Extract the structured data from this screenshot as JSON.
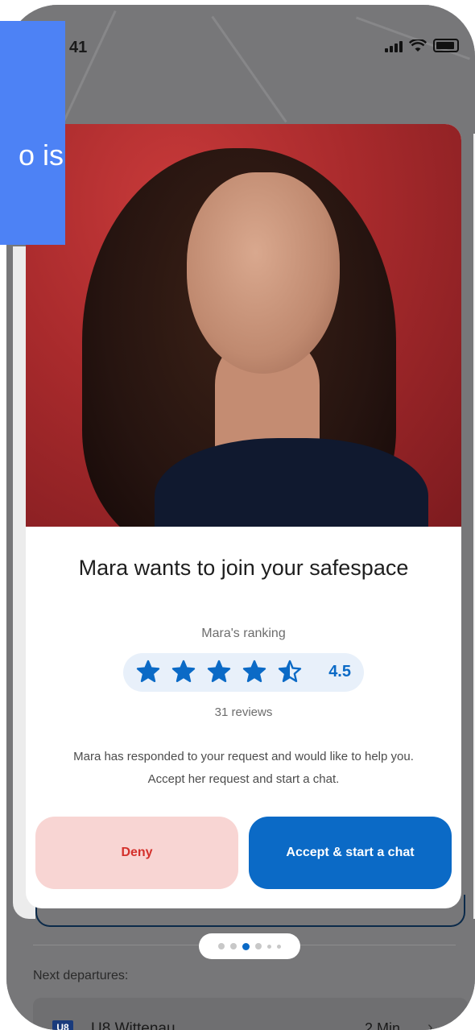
{
  "status_bar": {
    "time": "41"
  },
  "overlay": {
    "text": "o is"
  },
  "request_card": {
    "headline": "Mara wants to join your safespace",
    "ranking_label": "Mara's ranking",
    "rating": "4.5",
    "rating_value": 4.5,
    "reviews": "31 reviews",
    "message": "Mara has responded to your request and would like to help you. Accept her request and start a chat.",
    "deny_label": "Deny",
    "accept_label": "Accept & start a chat"
  },
  "pager": {
    "count": 6,
    "active_index": 2
  },
  "departures": {
    "label": "Next departures:",
    "items": [
      {
        "line": "U8",
        "name": "U8 Wittenau",
        "time": "2 Min"
      }
    ]
  },
  "colors": {
    "accent": "#0b6ac6",
    "deny_bg": "#f8d5d3",
    "deny_text": "#d4302b",
    "overlay": "#4d82f5"
  }
}
